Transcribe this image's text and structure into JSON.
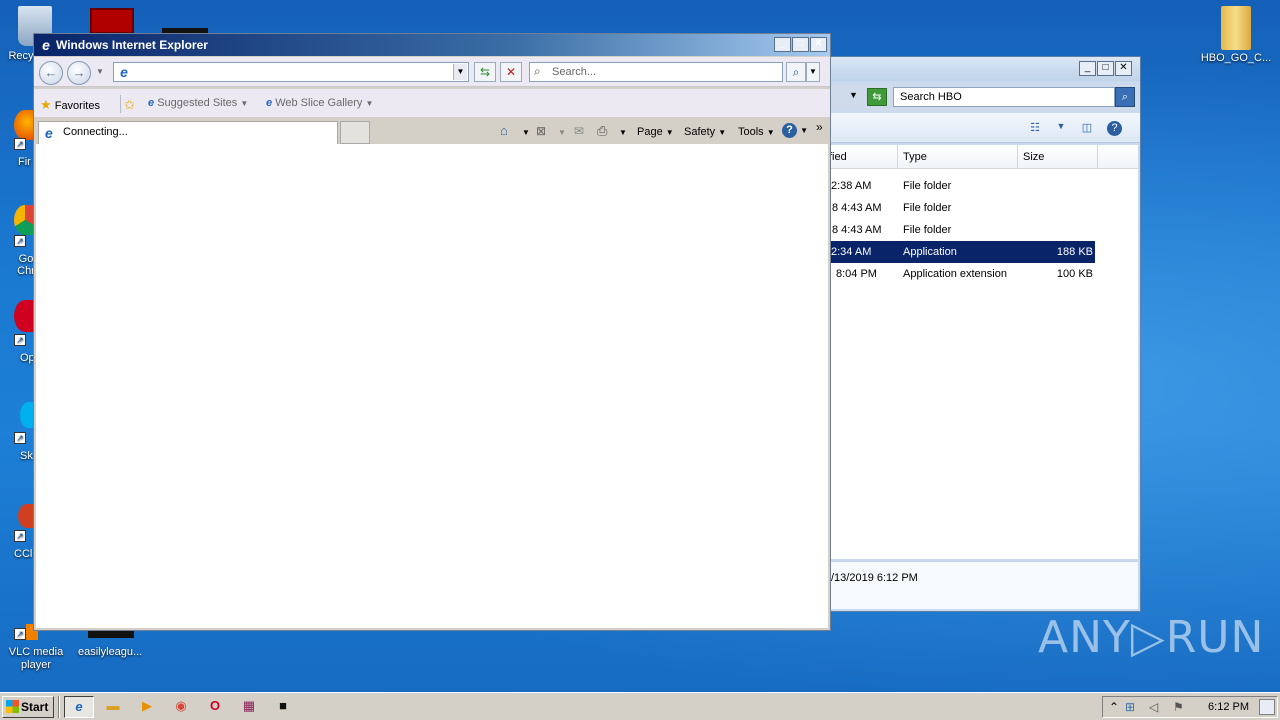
{
  "desktop": {
    "icons": [
      {
        "label": "Recy"
      },
      {
        "label": "Fir"
      },
      {
        "label": "Go Chr"
      },
      {
        "label": "Op"
      },
      {
        "label": "Sk"
      },
      {
        "label": "CCl"
      },
      {
        "label": "VLC media player"
      },
      {
        "label": "easilyleagu..."
      },
      {
        "label": "HBO_GO_C..."
      }
    ],
    "watermark": "ANY▷RUN"
  },
  "explorer": {
    "search_placeholder": "Search HBO",
    "columns": [
      "fied",
      "Type",
      "Size"
    ],
    "rows": [
      {
        "modified": "2:38 AM",
        "type": "File folder",
        "size": ""
      },
      {
        "modified": "8 4:43 AM",
        "type": "File folder",
        "size": ""
      },
      {
        "modified": "8 4:43 AM",
        "type": "File folder",
        "size": ""
      },
      {
        "modified": "2:34 AM",
        "type": "Application",
        "size": "188 KB",
        "selected": true
      },
      {
        "modified": "8:04 PM",
        "type": "Application extension",
        "size": "100 KB"
      }
    ],
    "details_text": "/13/2019 6:12 PM"
  },
  "ie": {
    "title": "Windows Internet Explorer",
    "address_value": "",
    "search_placeholder": "Search...",
    "favorites_label": "Favorites",
    "suggested_sites": "Suggested Sites",
    "web_slice_gallery": "Web Slice Gallery",
    "tab_label": "Connecting...",
    "cmd": {
      "page": "Page",
      "safety": "Safety",
      "tools": "Tools"
    }
  },
  "taskbar": {
    "start_label": "Start",
    "clock": "6:12 PM"
  },
  "colors": {
    "selection": "#0a246a",
    "title_gradient_start": "#0a246a",
    "desktop": "#1a78d0"
  }
}
